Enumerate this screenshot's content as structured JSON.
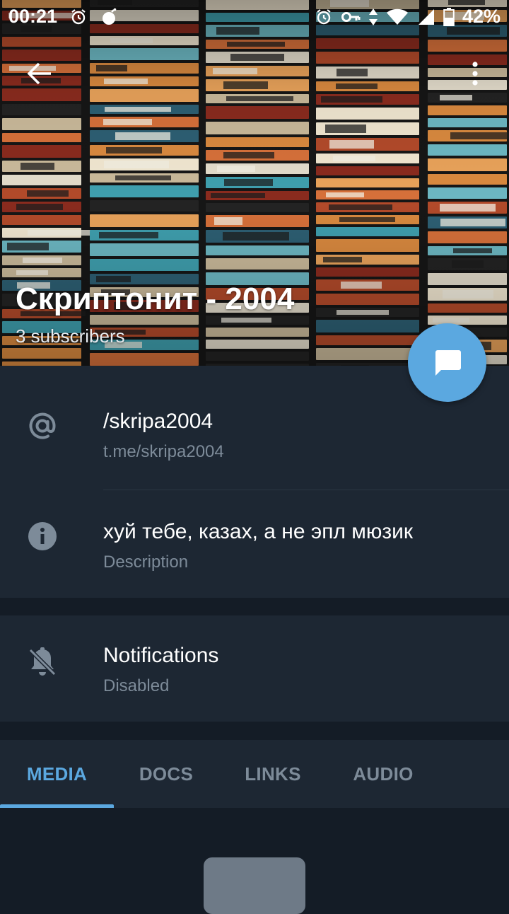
{
  "status_bar": {
    "time": "00:21",
    "battery_percent": "42%",
    "left_icons": [
      "alarm-icon",
      "bomb-icon"
    ],
    "right_icons": [
      "alarm-icon",
      "vpn-key-icon",
      "data-arrows-icon",
      "wifi-icon",
      "signal-icon",
      "battery-icon"
    ]
  },
  "toolbar": {
    "back_icon": "arrow-left-icon",
    "menu_icon": "more-vertical-icon"
  },
  "channel": {
    "title": "Скриптонит - 2004",
    "subscribers": "3 subscribers"
  },
  "fab": {
    "icon": "chat-bubble-icon",
    "color": "#5ba8e0"
  },
  "info": {
    "username": {
      "icon": "at-sign-icon",
      "value": "/skripa2004",
      "link": "t.me/skripa2004"
    },
    "description": {
      "icon": "info-icon",
      "value": "хуй тебе, казах, а не эпл мюзик",
      "label": "Description"
    }
  },
  "notifications": {
    "icon": "bell-off-icon",
    "title": "Notifications",
    "status": "Disabled"
  },
  "tabs": [
    {
      "label": "MEDIA",
      "active": true
    },
    {
      "label": "DOCS",
      "active": false
    },
    {
      "label": "LINKS",
      "active": false
    },
    {
      "label": "AUDIO",
      "active": false
    }
  ],
  "colors": {
    "accent": "#5ba8e0",
    "background": "#141c26",
    "surface": "#1d2733",
    "secondary_text": "#7d8b99"
  }
}
